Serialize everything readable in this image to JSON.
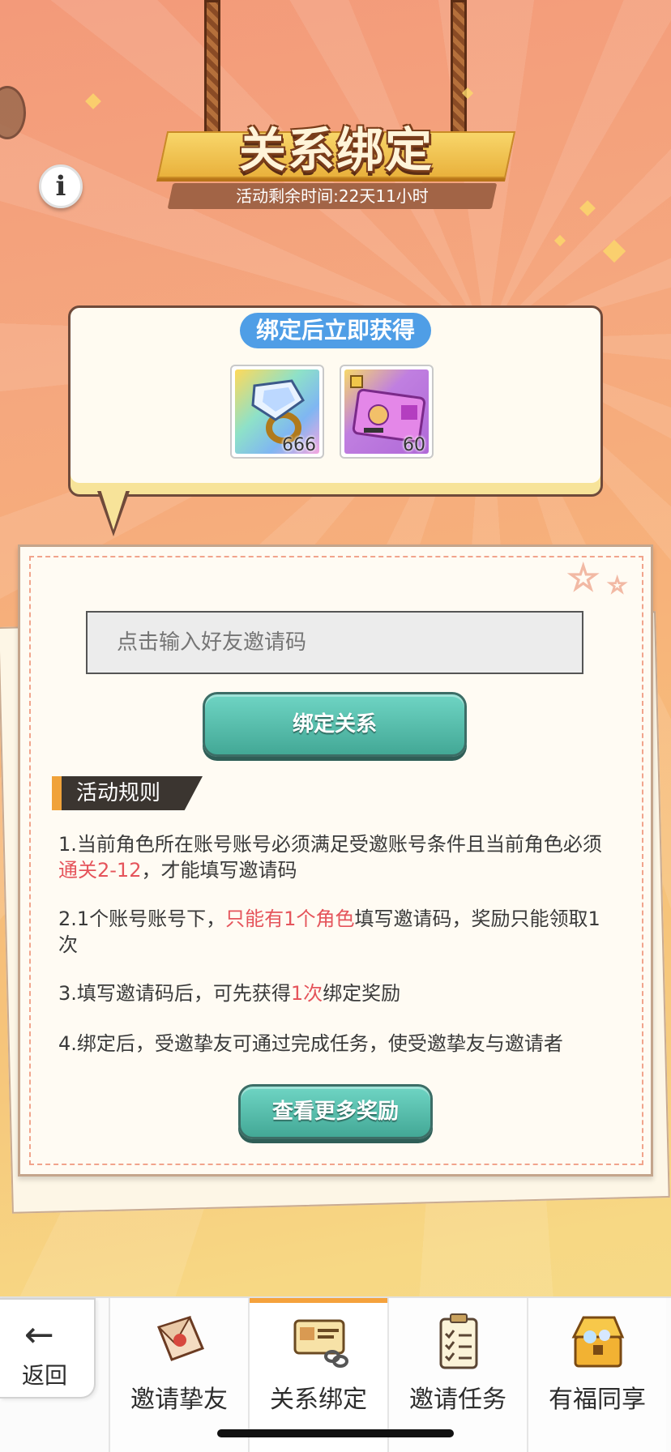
{
  "header": {
    "title": "关系绑定",
    "timer_text": "活动剩余时间:22天11小时"
  },
  "reward_box": {
    "label": "绑定后立即获得",
    "items": [
      {
        "icon": "diamond-ring-icon",
        "count": "666"
      },
      {
        "icon": "ticket-icon",
        "count": "60"
      }
    ]
  },
  "bind_form": {
    "input_placeholder": "点击输入好友邀请码",
    "bind_button": "绑定关系"
  },
  "rules": {
    "title": "活动规则",
    "items": [
      {
        "a": "1.当前角色所在账号账号必须满足受邀账号条件且当前角色必须",
        "hl": "通关2-12",
        "b": "，才能填写邀请码"
      },
      {
        "a": "2.1个账号账号下，",
        "hl": "只能有1个角色",
        "b": "填写邀请码，奖励只能领取1次"
      },
      {
        "a": "3.填写邀请码后，可先获得",
        "hl": "1次",
        "b": "绑定奖励"
      },
      {
        "a": "4.绑定后，受邀挚友可通过完成任务，使受邀挚友与邀请者",
        "hl": "",
        "b": ""
      }
    ],
    "more_button": "查看更多奖励"
  },
  "bottom_nav": {
    "back_label": "返回",
    "tabs": [
      {
        "label": "邀请挚友",
        "icon": "invite-letter-icon",
        "active": false
      },
      {
        "label": "关系绑定",
        "icon": "bind-card-icon",
        "active": true
      },
      {
        "label": "邀请任务",
        "icon": "task-clipboard-icon",
        "active": false
      },
      {
        "label": "有福同享",
        "icon": "treasure-box-icon",
        "active": false
      }
    ]
  },
  "colors": {
    "accent_blue": "#4f9ee6",
    "teal_button": "#43a896",
    "highlight_red": "#e5545b",
    "active_tab": "#f5a23c"
  }
}
